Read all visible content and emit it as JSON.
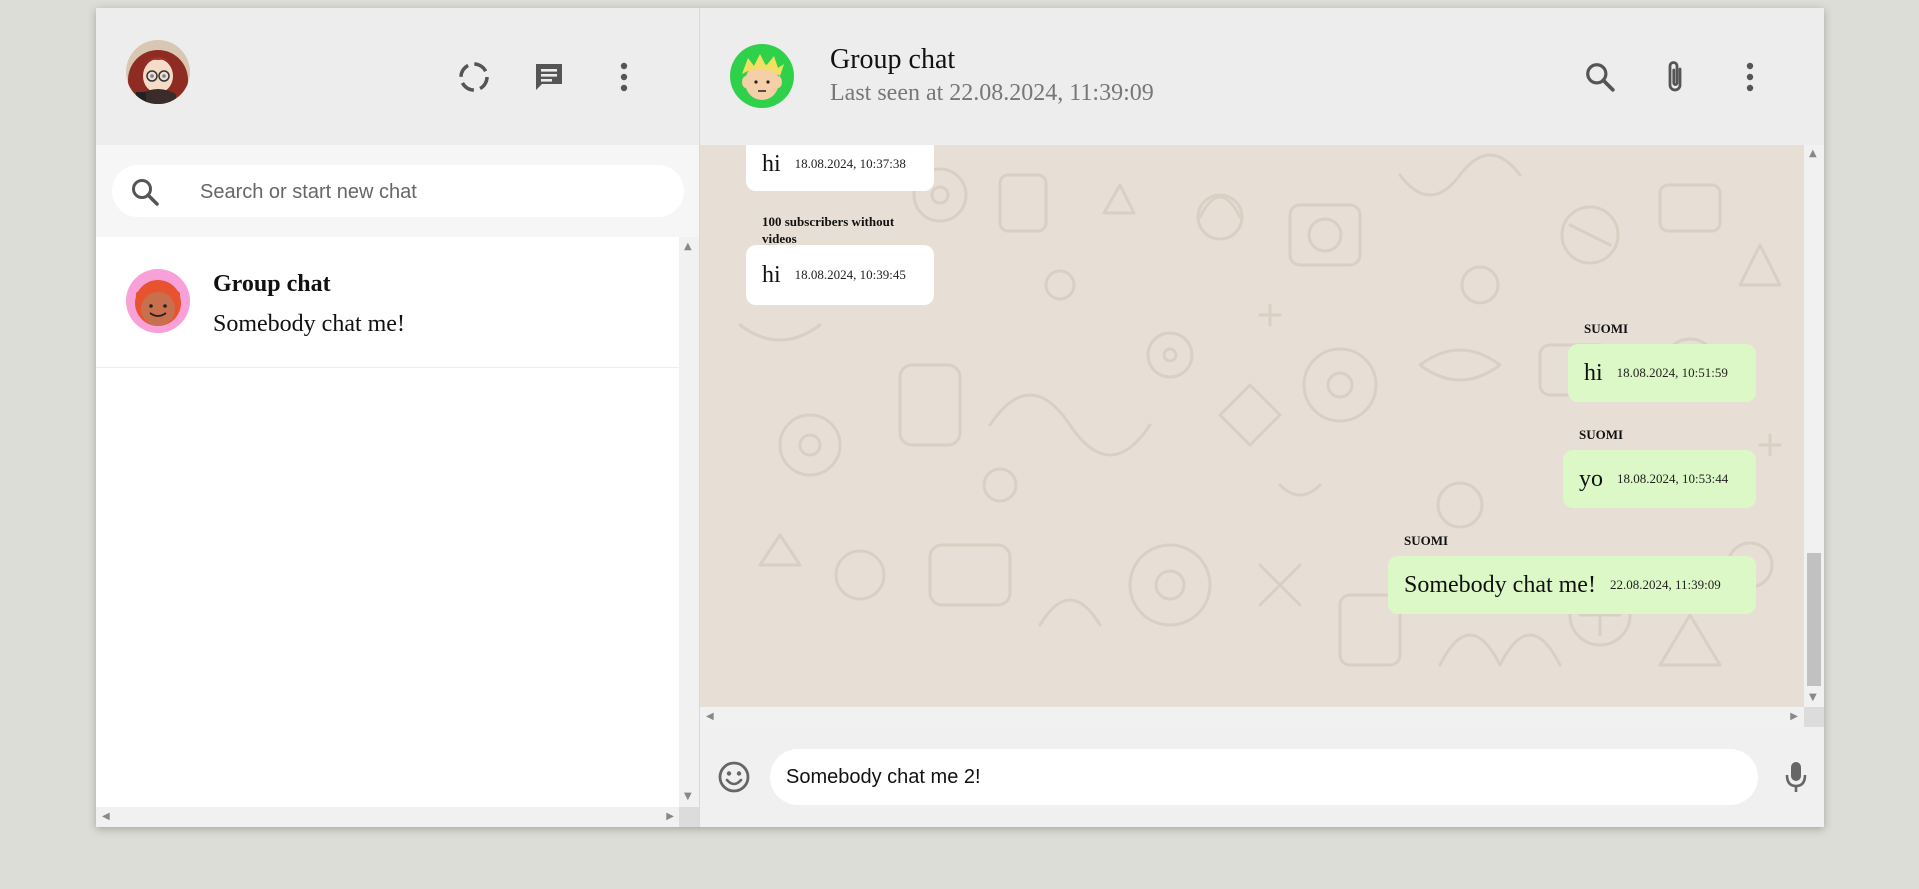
{
  "sidebar": {
    "search_placeholder": "Search or start new chat",
    "chats": [
      {
        "name": "Group chat",
        "last_message": "Somebody chat me!"
      }
    ]
  },
  "chat": {
    "title": "Group chat",
    "status": "Last seen at 22.08.2024, 11:39:09",
    "messages": [
      {
        "direction": "incoming",
        "sender": "",
        "text": "hi",
        "time": "18.08.2024, 10:37:38"
      },
      {
        "direction": "incoming",
        "sender": "100 subscribers without videos",
        "text": "hi",
        "time": "18.08.2024, 10:39:45"
      },
      {
        "direction": "outgoing",
        "sender": "SUOMI",
        "text": "hi",
        "time": "18.08.2024, 10:51:59"
      },
      {
        "direction": "outgoing",
        "sender": "SUOMI",
        "text": "yo",
        "time": "18.08.2024, 10:53:44"
      },
      {
        "direction": "outgoing",
        "sender": "SUOMI",
        "text": "Somebody chat me!",
        "time": "22.08.2024, 11:39:09"
      }
    ]
  },
  "composer": {
    "value": "Somebody chat me 2!"
  },
  "colors": {
    "background": "#dcddd6",
    "header": "#ededed",
    "incoming_bubble": "#ffffff",
    "outgoing_bubble": "#dcf8c6",
    "chat_wallpaper": "#e7dfd6"
  },
  "icons": {
    "status": "status-ring-icon",
    "new_chat": "chat-bubble-icon",
    "menu": "kebab-menu-icon",
    "search": "search-icon",
    "attach": "paperclip-icon",
    "emoji": "emoji-icon",
    "mic": "microphone-icon"
  }
}
